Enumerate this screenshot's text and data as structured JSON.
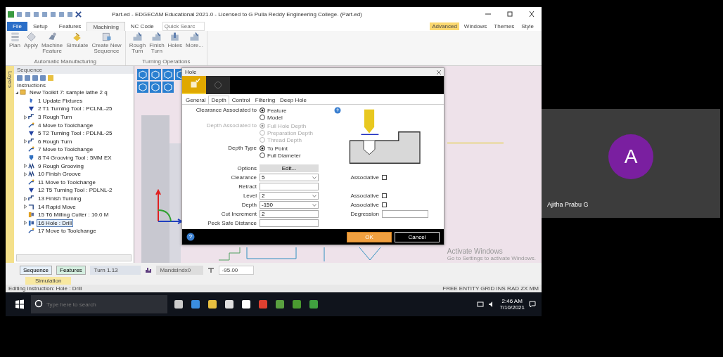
{
  "window": {
    "title": "Part.ed - EDGECAM Educational 2021.0 - Licensed to G Pulla Reddy Engineering College. (Part.ed)"
  },
  "ribbon_tabs": [
    {
      "label": "File",
      "selected": false,
      "kind": "file"
    },
    {
      "label": "Setup",
      "selected": false,
      "kind": "tab"
    },
    {
      "label": "Features",
      "selected": false,
      "kind": "tab"
    },
    {
      "label": "Machining",
      "selected": true,
      "kind": "tab"
    },
    {
      "label": "NC Code",
      "selected": false,
      "kind": "tab"
    }
  ],
  "quick_search": {
    "placeholder": "Quick Searc"
  },
  "ribbon_right": [
    {
      "label": "Advanced",
      "selected": true
    },
    {
      "label": "Windows",
      "selected": false
    },
    {
      "label": "Themes",
      "selected": false
    },
    {
      "label": "Style",
      "selected": false
    }
  ],
  "ribbon_groups": [
    {
      "label": "Automatic Manufacturing",
      "buttons": [
        {
          "label": "Plan",
          "kind": "plan"
        },
        {
          "label": "Apply",
          "kind": "apply"
        },
        {
          "label": "Machine\nFeature",
          "kind": "machine"
        },
        {
          "label": "Simulate",
          "kind": "simulate"
        },
        {
          "label": "Create New\nSequence",
          "kind": "sequence"
        }
      ]
    },
    {
      "label": "Turning Operations",
      "buttons": [
        {
          "label": "Rough\nTurn",
          "kind": "turn"
        },
        {
          "label": "Finish\nTurn",
          "kind": "turn"
        },
        {
          "label": "Holes",
          "kind": "holes"
        },
        {
          "label": "More...",
          "kind": "turn"
        }
      ]
    }
  ],
  "sequence_panel": {
    "title": "Sequence",
    "side_tab": "Layers",
    "section": "Instructions",
    "tree": [
      {
        "label": "New Toolkit 7: sample lathe 2 q",
        "kind": "root",
        "expandable": true,
        "selected": false,
        "children": [
          {
            "label": "1 Update Fixtures",
            "kind": "fixture",
            "expandable": false,
            "selected": false
          },
          {
            "label": "2 T1 Turning Tool : PCLNL-25",
            "kind": "tool",
            "expandable": false,
            "selected": false
          },
          {
            "label": "3 Rough Turn",
            "kind": "turn",
            "expandable": true,
            "selected": false
          },
          {
            "label": "4 Move to Toolchange",
            "kind": "move",
            "expandable": false,
            "selected": false
          },
          {
            "label": "5 T2 Turning Tool : PDLNL-25",
            "kind": "tool",
            "expandable": false,
            "selected": false
          },
          {
            "label": "6 Rough Turn",
            "kind": "turn",
            "expandable": true,
            "selected": false
          },
          {
            "label": "7 Move to Toolchange",
            "kind": "move",
            "expandable": false,
            "selected": false
          },
          {
            "label": "8 T4 Grooving Tool : 5MM EX",
            "kind": "groovetool",
            "expandable": false,
            "selected": false
          },
          {
            "label": "9 Rough Grooving",
            "kind": "groove",
            "expandable": true,
            "selected": false
          },
          {
            "label": "10 Finish Groove",
            "kind": "groove",
            "expandable": true,
            "selected": false
          },
          {
            "label": "11 Move to Toolchange",
            "kind": "move",
            "expandable": false,
            "selected": false
          },
          {
            "label": "12 T5 Turning Tool : PDLNL-2",
            "kind": "tool",
            "expandable": false,
            "selected": false
          },
          {
            "label": "13 Finish Turning",
            "kind": "turn",
            "expandable": true,
            "selected": false
          },
          {
            "label": "14 Rapid Move",
            "kind": "rapid",
            "expandable": true,
            "selected": false
          },
          {
            "label": "15 T6 Milling Cutter : 10.0 M",
            "kind": "mill",
            "expandable": false,
            "selected": false
          },
          {
            "label": "16 Hole : Drill",
            "kind": "hole",
            "expandable": true,
            "selected": true
          },
          {
            "label": "17 Move to Toolchange",
            "kind": "move",
            "expandable": false,
            "selected": false
          }
        ]
      }
    ],
    "bottom_tabs": [
      {
        "label": "Sequence",
        "selected": true
      },
      {
        "label": "Features",
        "selected": false
      }
    ]
  },
  "simulation_button": "Simulation",
  "viewport_bar": {
    "turn": "Turn 1.13",
    "mandrel": "MandsIndx0",
    "angle": "-95.00"
  },
  "dialog": {
    "title": "Hole",
    "header_tiles": [
      {
        "kind": "feature",
        "selected": true
      },
      {
        "kind": "target",
        "selected": false
      }
    ],
    "tabs": [
      {
        "label": "General",
        "selected": false
      },
      {
        "label": "Depth",
        "selected": true
      },
      {
        "label": "Control",
        "selected": false
      },
      {
        "label": "Filtering",
        "selected": false
      },
      {
        "label": "Deep Hole",
        "selected": false
      }
    ],
    "radio_groups": [
      {
        "label": "Clearance Associated to",
        "disabled": false,
        "options": [
          {
            "label": "Feature",
            "selected": true
          },
          {
            "label": "Model",
            "selected": false
          }
        ]
      },
      {
        "label": "Depth Associated to",
        "disabled": true,
        "options": [
          {
            "label": "Full Hole Depth",
            "selected": true
          },
          {
            "label": "Preparation Depth",
            "selected": false
          },
          {
            "label": "Thread Depth",
            "selected": false
          }
        ]
      },
      {
        "label": "Depth Type",
        "disabled": false,
        "options": [
          {
            "label": "To Point",
            "selected": true
          },
          {
            "label": "Full Diameter",
            "selected": false
          }
        ]
      }
    ],
    "options_row": {
      "label": "Options",
      "button": "Edit..."
    },
    "fields": [
      {
        "label": "Clearance",
        "value": "5",
        "kind": "dropdown",
        "side": {
          "label": "Associative",
          "kind": "checkbox",
          "checked": false
        }
      },
      {
        "label": "Retract",
        "kind": "text"
      },
      {
        "label": "Level",
        "value": "2",
        "kind": "dropdown",
        "side": {
          "label": "Associative",
          "kind": "checkbox",
          "checked": false
        }
      },
      {
        "label": "Depth",
        "value": "-150",
        "kind": "dropdown",
        "side": {
          "label": "Associative",
          "kind": "checkbox",
          "checked": false
        }
      },
      {
        "label": "Cut Increment",
        "value": "2",
        "kind": "text",
        "side": {
          "label": "Degression",
          "kind": "text"
        }
      },
      {
        "label": "Peck Safe Distance",
        "kind": "text"
      }
    ],
    "buttons": [
      {
        "label": "OK",
        "kind": "primary"
      },
      {
        "label": "Cancel",
        "kind": "secondary"
      }
    ]
  },
  "status_bar": {
    "message": "Editing instruction:  Hole : Drill",
    "indicators": "FREE ENTITY GRID INS RAD ZX MM"
  },
  "activation": {
    "title": "Activate Windows",
    "subtitle": "Go to Settings to activate Windows."
  },
  "taskbar": {
    "search_placeholder": "Type here to search",
    "time": "2:46 AM",
    "date": "7/10/2021"
  },
  "participant": {
    "initial": "A",
    "name": "Ajitha Prabu G"
  }
}
